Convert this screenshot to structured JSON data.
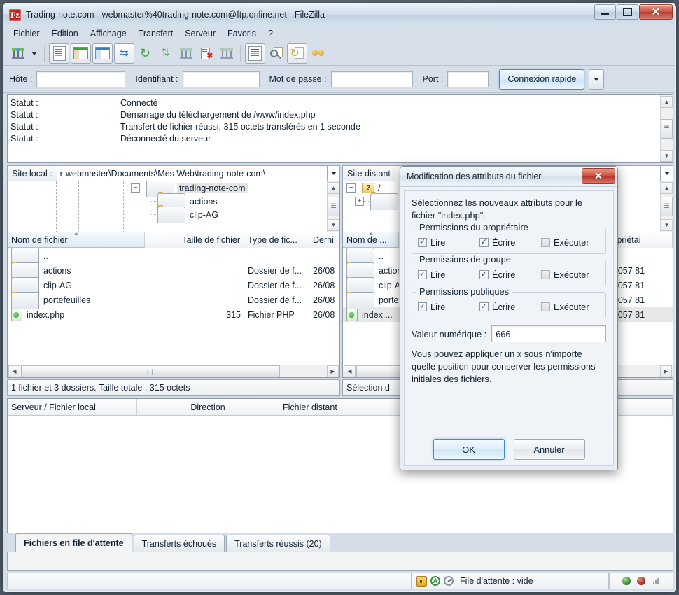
{
  "window": {
    "title": "Trading-note.com - webmaster%40trading-note.com@ftp.online.net - FileZilla",
    "app_icon": "filezilla-icon",
    "minimize": "–",
    "maximize": "□",
    "close": "✕"
  },
  "menu": {
    "items": [
      {
        "label": "Fichier"
      },
      {
        "label": "Édition"
      },
      {
        "label": "Affichage"
      },
      {
        "label": "Transfert"
      },
      {
        "label": "Serveur"
      },
      {
        "label": "Favoris"
      },
      {
        "label": "?"
      }
    ]
  },
  "toolbar": {
    "buttons": [
      {
        "name": "site-manager-icon",
        "title": "Gestionnaire de Sites"
      },
      {
        "name": "site-manager-dropdown-icon",
        "title": "Ouvrir le gestionnaire de sites"
      },
      {
        "name": "toggle-message-log-icon",
        "title": "Afficher le journal de messages"
      },
      {
        "name": "toggle-local-tree-icon",
        "title": "Afficher l'arborescence locale"
      },
      {
        "name": "toggle-remote-tree-icon",
        "title": "Afficher l'arborescence distante"
      },
      {
        "name": "toggle-transfer-queue-icon",
        "title": "Afficher la file de transfert"
      },
      {
        "name": "refresh-icon",
        "title": "Actualiser"
      },
      {
        "name": "process-queue-icon",
        "title": "Traiter la file d'attente"
      },
      {
        "name": "disconnect-icon",
        "title": "Déconnexion"
      },
      {
        "name": "cancel-operation-icon",
        "title": "Annuler l'opération"
      },
      {
        "name": "reconnect-icon",
        "title": "Reconnexion"
      },
      {
        "name": "filter-icon",
        "title": "Filtres de noms de fichiers"
      },
      {
        "name": "compare-directories-icon",
        "title": "Comparaison de répertoires"
      },
      {
        "name": "synchronized-browsing-icon",
        "title": "Navigation synchronisée"
      },
      {
        "name": "search-remote-files-icon",
        "title": "Recherche de fichiers distants"
      }
    ]
  },
  "quickconnect": {
    "host_label": "Hôte :",
    "host_value": "",
    "user_label": "Identifiant :",
    "user_value": "",
    "password_label": "Mot de passe :",
    "password_value": "",
    "port_label": "Port :",
    "port_value": "",
    "connect_label": "Connexion rapide",
    "dropdown_icon": "chevron-down-icon"
  },
  "log": {
    "rows": [
      {
        "key": "Statut :",
        "value": "Connecté"
      },
      {
        "key": "Statut :",
        "value": "Démarrage du téléchargement de /www/index.php"
      },
      {
        "key": "Statut :",
        "value": "Transfert de fichier réussi, 315 octets transférés en 1 seconde"
      },
      {
        "key": "Statut :",
        "value": "Déconnecté du serveur"
      }
    ]
  },
  "local": {
    "path_label": "Site local :",
    "path_value": "r-webmaster\\Documents\\Mes Web\\trading-note-com\\",
    "tree": [
      {
        "label": "trading-note-com",
        "expander": "−",
        "selected": true
      },
      {
        "label": "actions",
        "expander": "",
        "selected": false
      },
      {
        "label": "clip-AG",
        "expander": "",
        "selected": false
      }
    ],
    "columns": [
      {
        "label": "Nom de fichier",
        "sorted": true
      },
      {
        "label": "Taille de fichier",
        "sorted": false
      },
      {
        "label": "Type de fic...",
        "sorted": false
      },
      {
        "label": "Derni",
        "sorted": false
      }
    ],
    "rows": [
      {
        "name": "..",
        "size": "",
        "type": "",
        "date": "",
        "icon": "folder-icon"
      },
      {
        "name": "actions",
        "size": "",
        "type": "Dossier de f...",
        "date": "26/08",
        "icon": "folder-icon"
      },
      {
        "name": "clip-AG",
        "size": "",
        "type": "Dossier de f...",
        "date": "26/08",
        "icon": "folder-icon"
      },
      {
        "name": "portefeuilles",
        "size": "",
        "type": "Dossier de f...",
        "date": "26/08",
        "icon": "folder-icon"
      },
      {
        "name": "index.php",
        "size": "315",
        "type": "Fichier PHP",
        "date": "26/08",
        "icon": "php-file-icon"
      }
    ],
    "status": "1 fichier et 3 dossiers. Taille totale : 315 octets"
  },
  "remote": {
    "path_label": "Site distant",
    "path_value": "",
    "tree": [
      {
        "label": "/",
        "expander": "−",
        "icon": "unknown-folder-icon"
      },
      {
        "label": "w",
        "expander": "+",
        "icon": "folder-icon"
      }
    ],
    "columns": [
      {
        "label": "Nom de ...",
        "sorted": true
      },
      {
        "label": "Propriétai",
        "sorted": false
      }
    ],
    "rows": [
      {
        "name": "..",
        "owner": "",
        "icon": "folder-icon"
      },
      {
        "name": "actions",
        "owner": "337057 81",
        "icon": "folder-icon"
      },
      {
        "name": "clip-AG",
        "owner": "337057 81",
        "icon": "folder-icon"
      },
      {
        "name": "portef...",
        "owner": "337057 81",
        "icon": "folder-icon"
      },
      {
        "name": "index....",
        "owner": "337057 81",
        "icon": "php-file-icon",
        "selected": true
      }
    ],
    "status": "Sélection d"
  },
  "queue": {
    "columns": [
      {
        "label": "Serveur / Fichier local"
      },
      {
        "label": "Direction"
      },
      {
        "label": "Fichier distant"
      }
    ],
    "tabs": [
      {
        "label": "Fichiers en file d'attente",
        "active": true
      },
      {
        "label": "Transferts échoués",
        "active": false
      },
      {
        "label": "Transferts réussis (20)",
        "active": false
      }
    ]
  },
  "statusbar": {
    "lock_icon": "lock-icon",
    "gear_icon": "gear-a-icon",
    "speed_icon": "speed-limit-icon",
    "queue_text": "File d'attente : vide",
    "led_green": "#2c7a25",
    "led_red": "#9b2a1f"
  },
  "dialog": {
    "title": "Modification des attributs du fichier",
    "close_label": "✕",
    "intro": "Sélectionnez les nouveaux attributs pour le fichier \"index.php\".",
    "groups": [
      {
        "legend": "Permissions du propriétaire",
        "checks": [
          {
            "label": "Lire",
            "checked": true
          },
          {
            "label": "Écrire",
            "checked": true
          },
          {
            "label": "Exécuter",
            "checked": false
          }
        ]
      },
      {
        "legend": "Permissions de groupe",
        "checks": [
          {
            "label": "Lire",
            "checked": true
          },
          {
            "label": "Écrire",
            "checked": true
          },
          {
            "label": "Exécuter",
            "checked": false
          }
        ]
      },
      {
        "legend": "Permissions publiques",
        "checks": [
          {
            "label": "Lire",
            "checked": true
          },
          {
            "label": "Écrire",
            "checked": true
          },
          {
            "label": "Exécuter",
            "checked": false
          }
        ]
      }
    ],
    "numeric_label": "Valeur numérique :",
    "numeric_value": "666",
    "note": "Vous pouvez appliquer un x sous n'importe quelle position pour conserver les permissions initiales des fichiers.",
    "ok_label": "OK",
    "cancel_label": "Annuler",
    "check_glyph": "✓"
  },
  "scroll": {
    "up": "▲",
    "down": "▼",
    "left": "◀",
    "right": "▶",
    "grip": "≡",
    "hgrip": "|||"
  }
}
